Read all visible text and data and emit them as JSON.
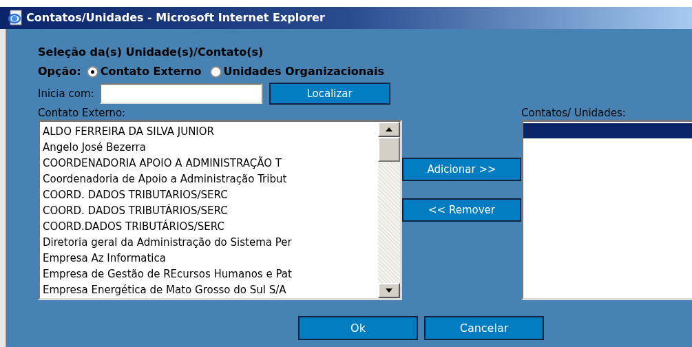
{
  "window": {
    "title": "Contatos/Unidades - Microsoft Internet Explorer"
  },
  "heading": "Seleção da(s) Unidade(s)/Contato(s)",
  "option": {
    "label": "Opção:",
    "choices": [
      {
        "label": "Contato Externo",
        "selected": true
      },
      {
        "label": "Unidades Organizacionais",
        "selected": false
      }
    ]
  },
  "search": {
    "label": "Inicia com:",
    "button": "Localizar"
  },
  "source_list": {
    "label": "Contato Externo:",
    "items": [
      {
        "text": "ALDO FERREIRA DA SILVA JUNIOR"
      },
      {
        "text": "Angelo José Bezerra"
      },
      {
        "text": "COORDENADORIA APOIO A ADMINISTRAÇÃO T"
      },
      {
        "text": "Coordenadoria de Apoio a Administração Tribut"
      },
      {
        "text": "COORD. DADOS TRIBUTARIOS/SERC"
      },
      {
        "text": "COORD. DADOS TRIBUTÁRIOS/SERC"
      },
      {
        "text": "COORD.DADOS TRIBUTÁRIOS/SERC"
      },
      {
        "text": "Diretoria geral da Administração do Sistema Per"
      },
      {
        "text": "Empresa Az Informatica"
      },
      {
        "text": "Empresa de Gestão de REcursos Humanos e Pat"
      },
      {
        "text": "Empresa Energética de Mato Grosso do Sul S/A"
      }
    ]
  },
  "transfer_buttons": [
    "Adicionar >>",
    "<< Remover"
  ],
  "target_list": {
    "label": "Contatos/ Unidades:",
    "rows": [
      {
        "selected": true
      }
    ]
  },
  "buttons": [
    "Ok",
    "Cancelar"
  ]
}
